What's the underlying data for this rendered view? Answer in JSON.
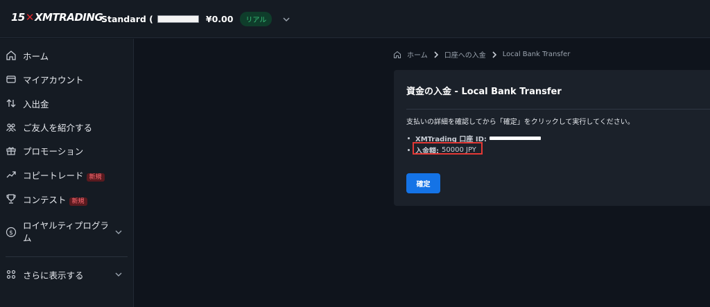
{
  "header": {
    "logo_num": "15",
    "logo_text": "XMTRADING",
    "account_type": "Standard (",
    "balance": "¥0.00",
    "badge": "リアル"
  },
  "sidebar": {
    "items": [
      {
        "label": "ホーム",
        "icon": "home-icon"
      },
      {
        "label": "マイアカウント",
        "icon": "wallet-icon"
      },
      {
        "label": "入出金",
        "icon": "transfer-icon"
      },
      {
        "label": "ご友人を紹介する",
        "icon": "friends-icon"
      },
      {
        "label": "プロモーション",
        "icon": "gift-icon"
      },
      {
        "label": "コピートレード",
        "icon": "trend-icon",
        "badge": "新規"
      },
      {
        "label": "コンテスト",
        "icon": "trophy-icon",
        "badge": "新規"
      },
      {
        "label_line1": "ロイヤルティプログラ",
        "label_line2": "ム",
        "icon": "dollar-coin-icon"
      },
      {
        "label": "さらに表示する",
        "icon": "grid-icon"
      }
    ]
  },
  "breadcrumb": {
    "home": "ホーム",
    "level2": "口座への入金",
    "current": "Local Bank Transfer"
  },
  "card": {
    "title": "資金の入金 - Local Bank Transfer",
    "description": "支払いの詳細を確認してから「確定」をクリックして実行してください。",
    "account_label": "XMTrading 口座 ID:",
    "amount_label": "入金額:",
    "amount_value": "50000 JPY",
    "confirm_label": "確定"
  }
}
